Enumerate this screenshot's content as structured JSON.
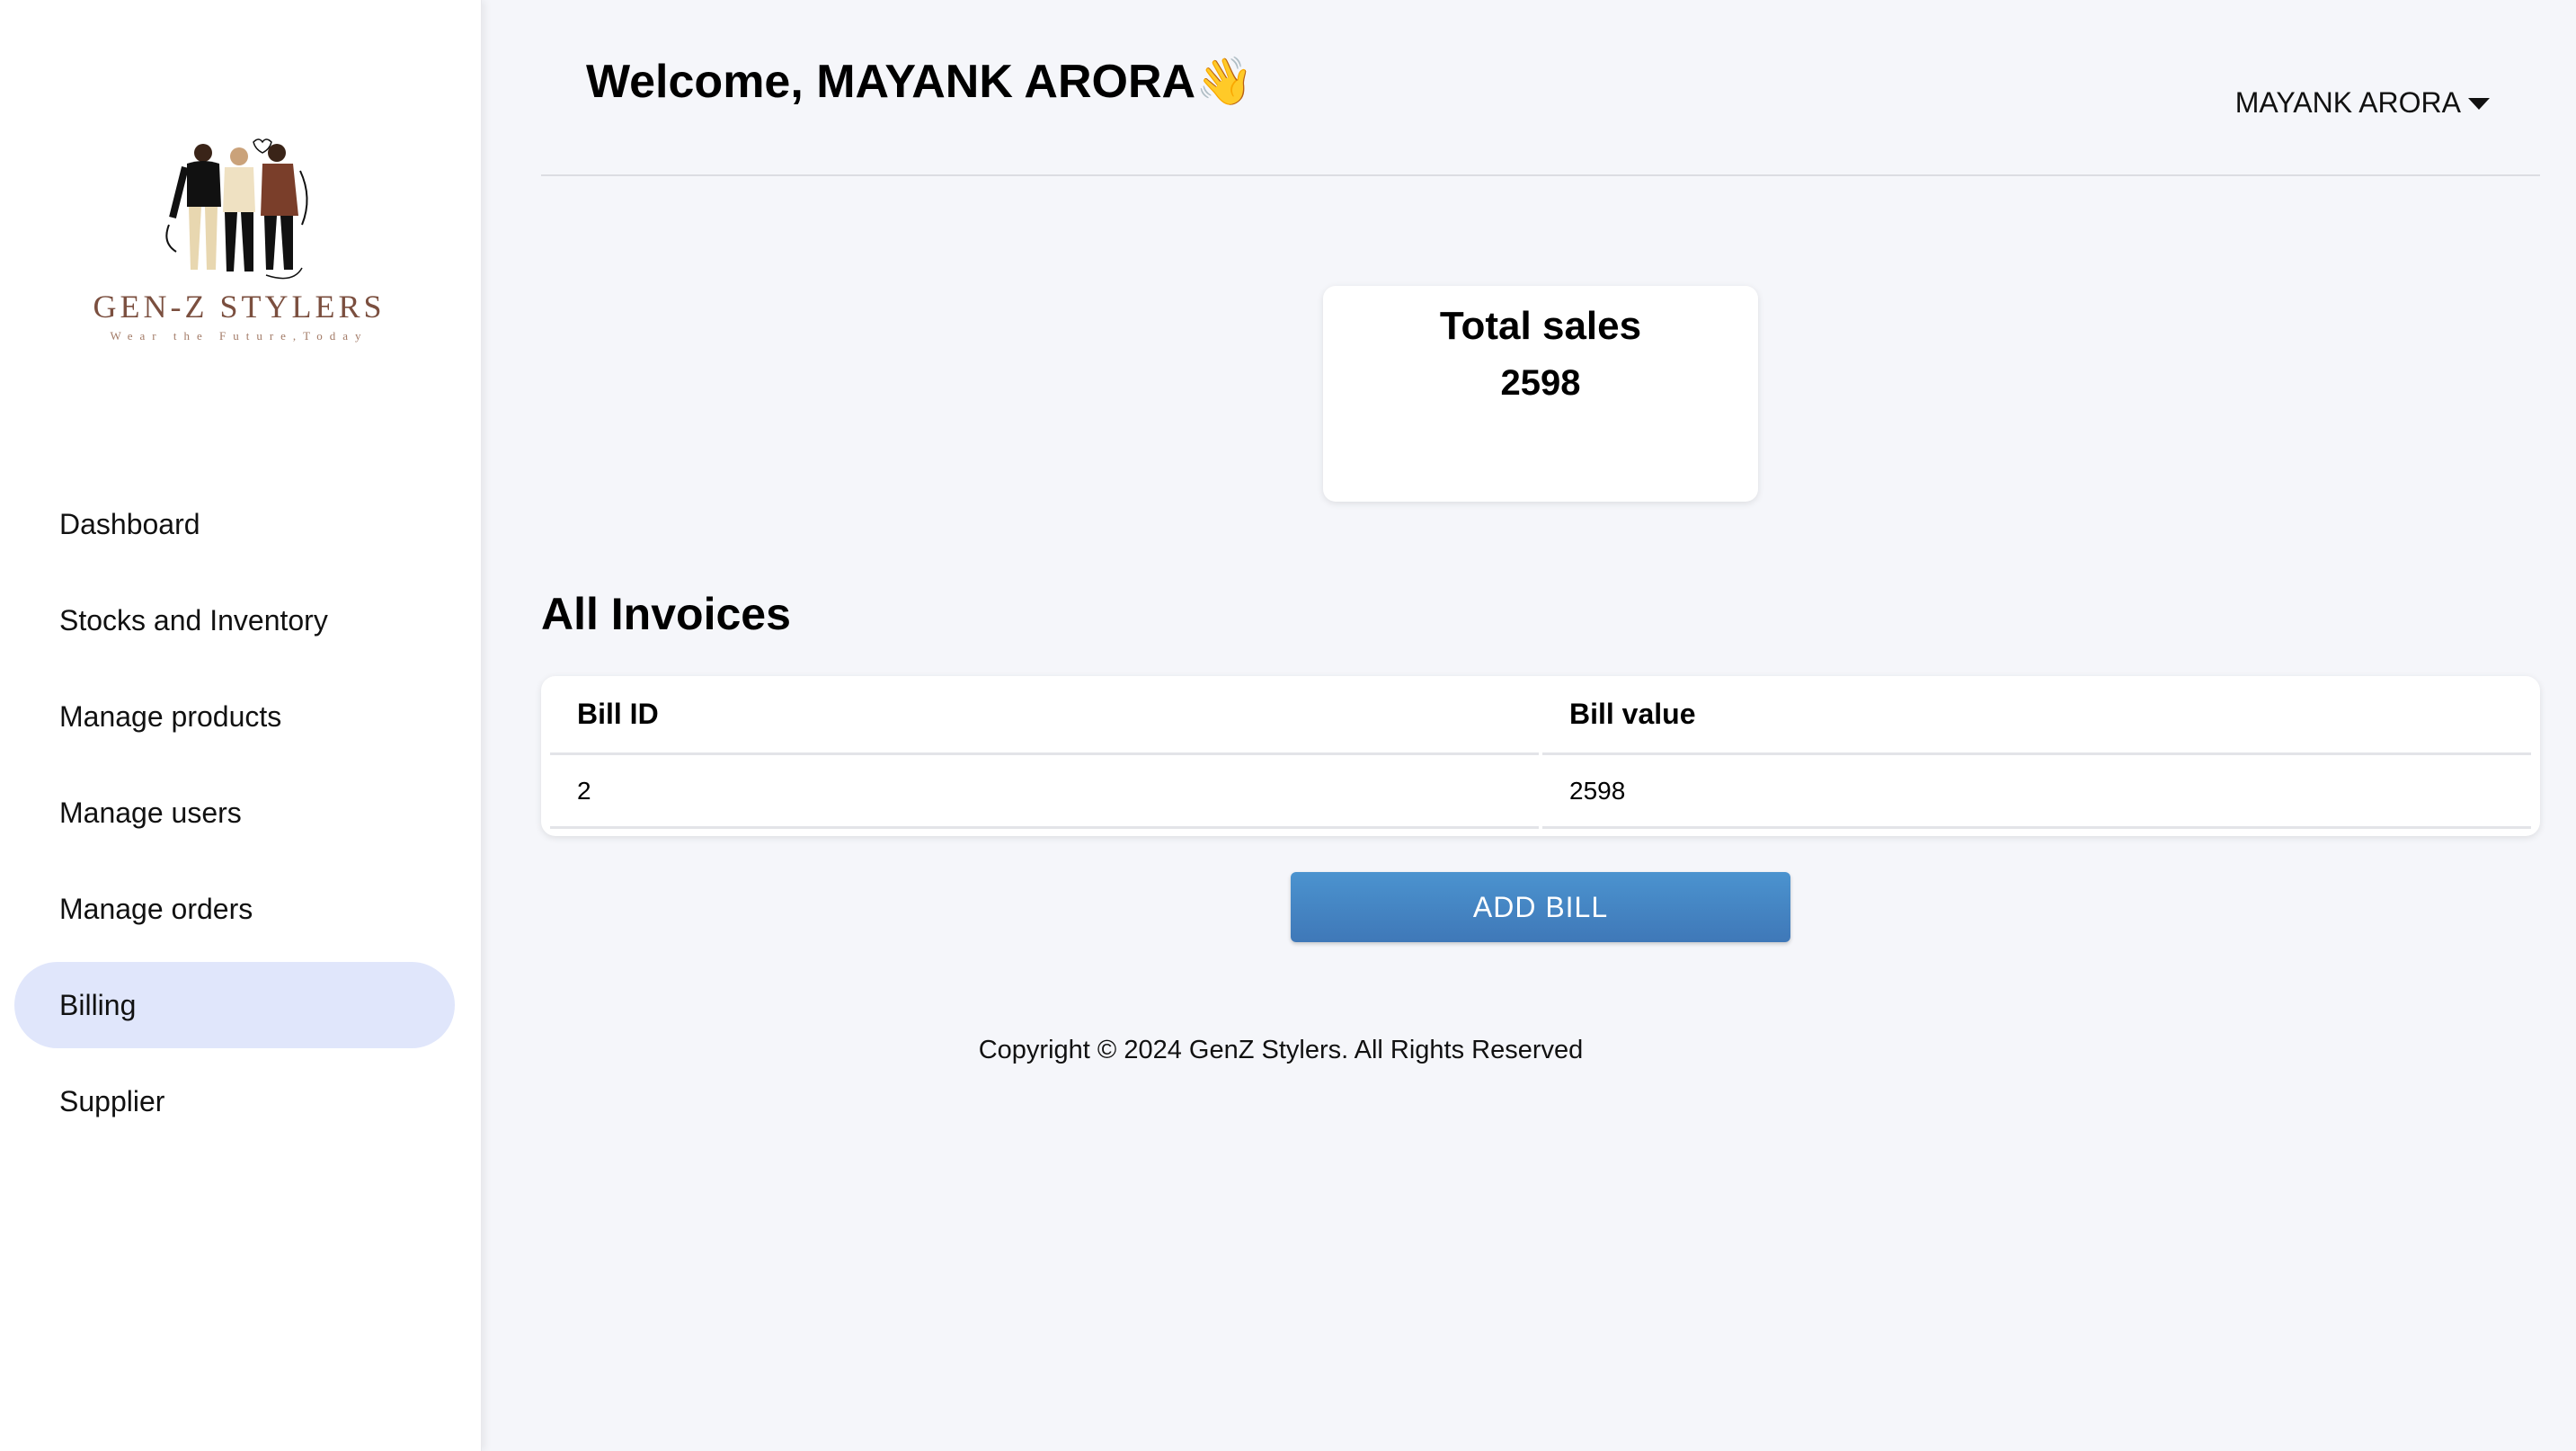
{
  "brand": {
    "name": "GEN-Z STYLERS",
    "tagline": "Wear the Future,Today"
  },
  "sidebar": {
    "items": [
      {
        "label": "Dashboard"
      },
      {
        "label": "Stocks and Inventory"
      },
      {
        "label": "Manage products"
      },
      {
        "label": "Manage users"
      },
      {
        "label": "Manage orders"
      },
      {
        "label": "Billing",
        "active": true
      },
      {
        "label": "Supplier"
      }
    ]
  },
  "header": {
    "welcome": "Welcome, MAYANK ARORA👋",
    "user_name": "MAYANK ARORA",
    "user_menu_icon": "caret-down-icon"
  },
  "summary": {
    "label": "Total sales",
    "value": "2598"
  },
  "invoices": {
    "title": "All Invoices",
    "columns": [
      "Bill ID",
      "Bill value"
    ],
    "rows": [
      [
        "2",
        "2598"
      ]
    ]
  },
  "actions": {
    "add_bill_label": "ADD BILL"
  },
  "footer": {
    "copyright": "Copyright © 2024 GenZ Stylers. All Rights Reserved"
  },
  "colors": {
    "accent": "#3f78b8",
    "active_nav_bg": "#e0e6fb",
    "page_bg": "#f5f6fa",
    "brand_text": "#7b4f3f"
  }
}
